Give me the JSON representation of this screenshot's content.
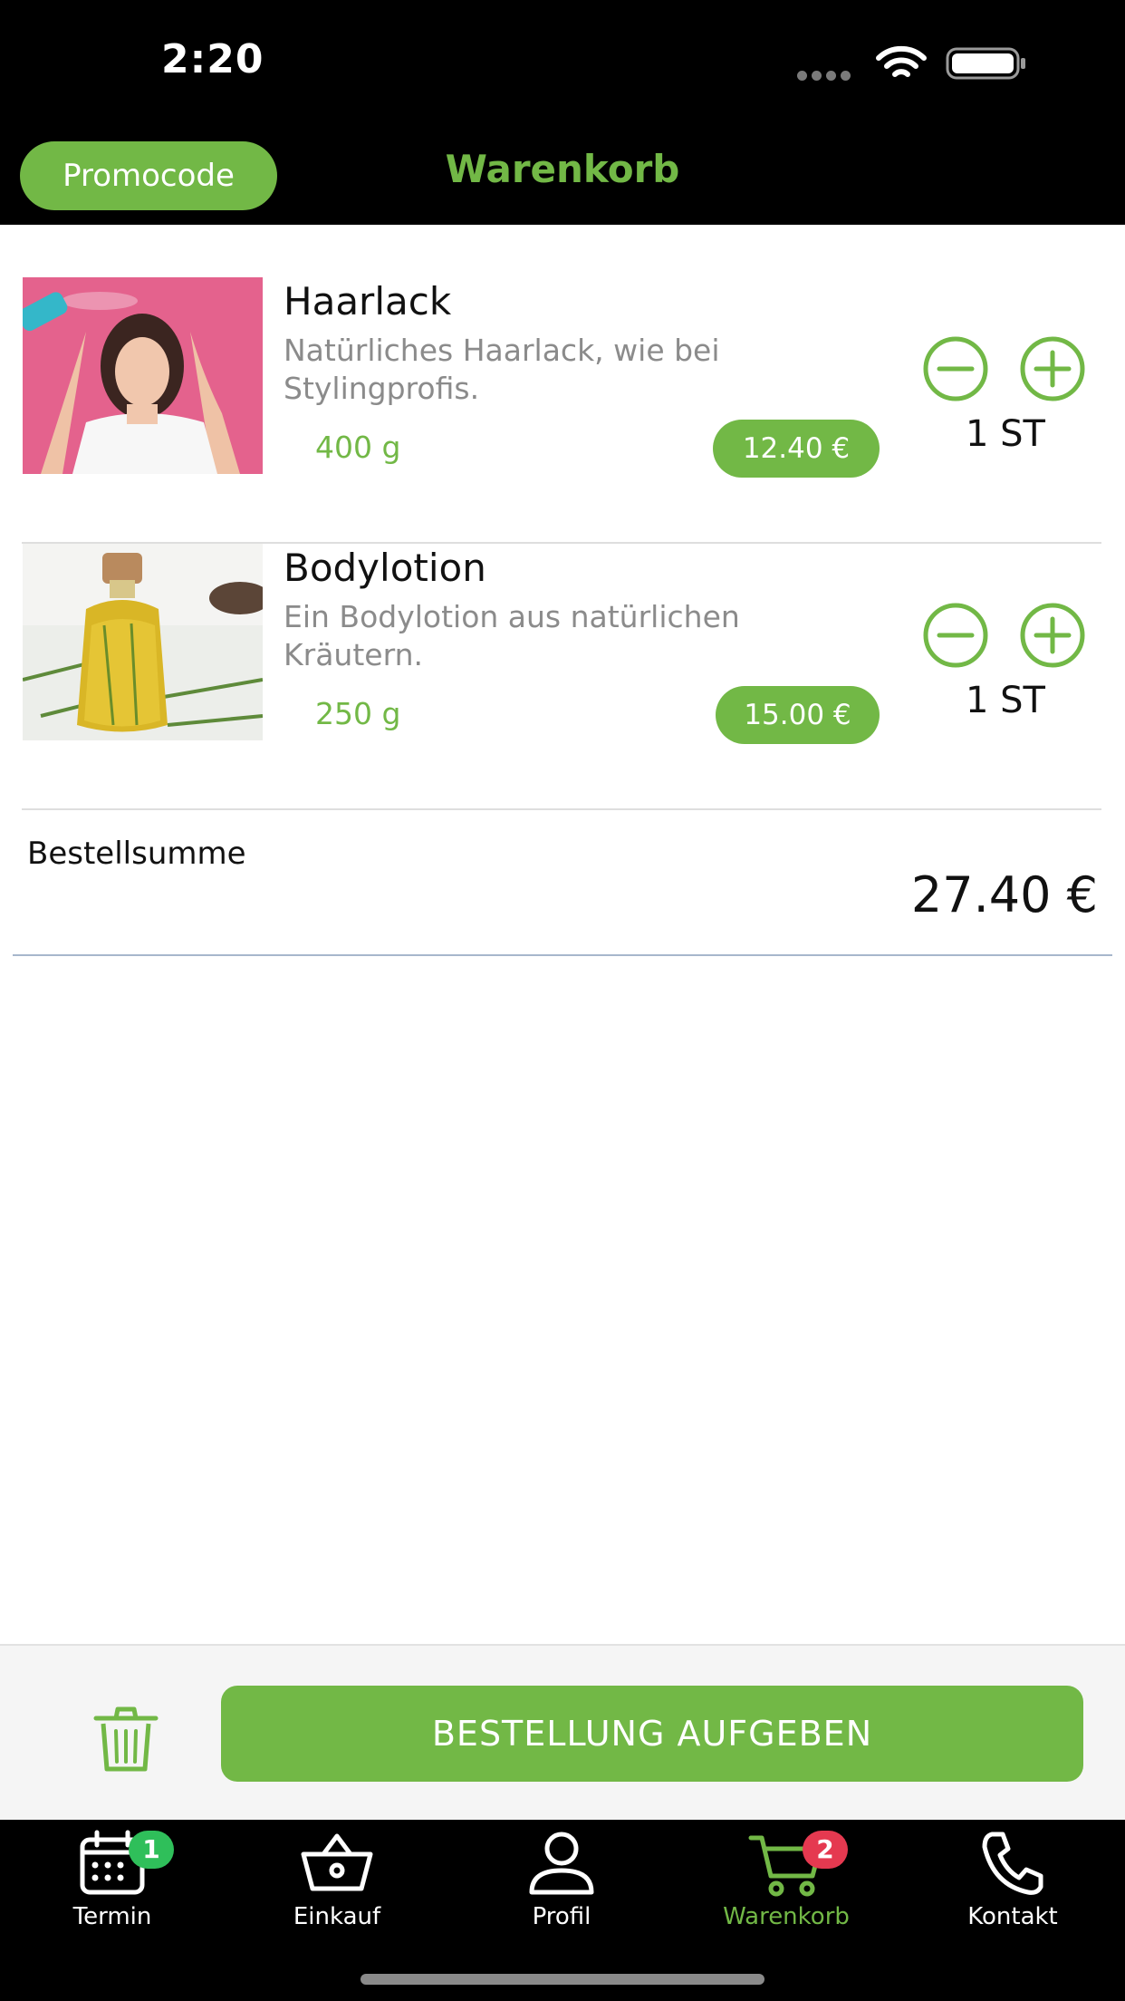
{
  "status_bar": {
    "time": "2:20"
  },
  "header": {
    "promo_label": "Promocode",
    "title": "Warenkorb"
  },
  "cart": {
    "items": [
      {
        "name": "Haarlack",
        "description": "Natürliches Haarlack, wie bei Stylingprofis.",
        "weight": "400 g",
        "price": "12.40 €",
        "quantity": "1 ST"
      },
      {
        "name": "Bodylotion",
        "description": "Ein Bodylotion aus natürlichen Kräutern.",
        "weight": "250 g",
        "price": "15.00 €",
        "quantity": "1 ST"
      }
    ]
  },
  "summary": {
    "label": "Bestellsumme",
    "total": "27.40 €"
  },
  "actions": {
    "order_label": "BESTELLUNG AUFGEBEN"
  },
  "tabs": [
    {
      "label": "Termin",
      "icon": "calendar-icon",
      "badge": "1",
      "active": false
    },
    {
      "label": "Einkauf",
      "icon": "basket-icon",
      "active": false
    },
    {
      "label": "Profil",
      "icon": "user-icon",
      "active": false
    },
    {
      "label": "Warenkorb",
      "icon": "cart-icon",
      "badge": "2",
      "active": true
    },
    {
      "label": "Kontakt",
      "icon": "phone-icon",
      "active": false
    }
  ],
  "colors": {
    "accent": "#72b846",
    "badge_green": "#2fbf5a",
    "badge_red": "#e53950",
    "bar_background": "#000000"
  }
}
